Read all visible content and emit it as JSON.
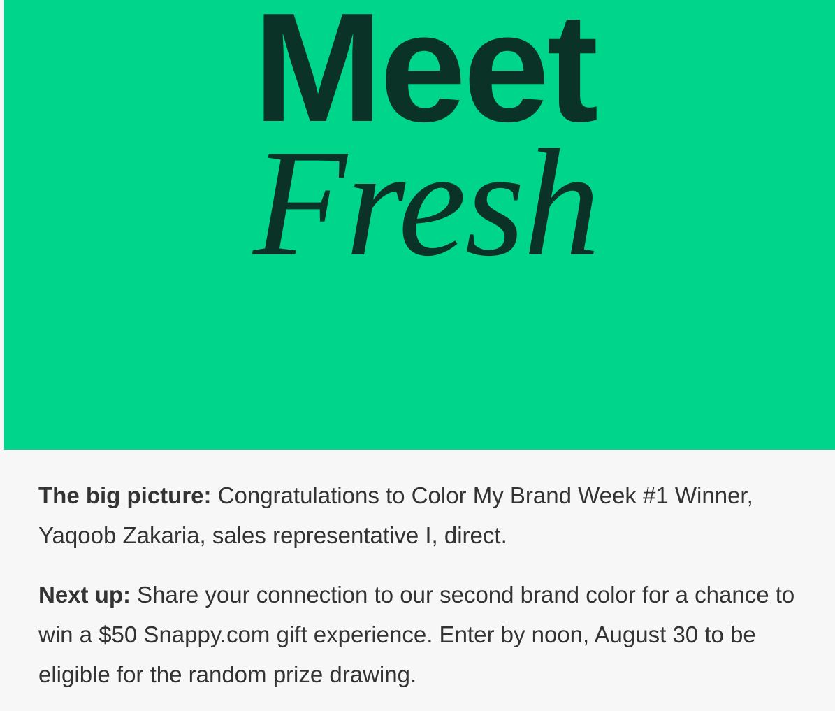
{
  "colors": {
    "hero_background": "#00d68b",
    "hero_text": "#0b3227",
    "body_text": "#333333",
    "page_background": "#f7f7f7"
  },
  "hero": {
    "line1": "Meet",
    "line2": "Fresh"
  },
  "paragraphs": [
    {
      "lead": "The big picture:",
      "text": " Congratulations to Color My Brand Week #1 Winner, Yaqoob Zakaria, sales representative I, direct."
    },
    {
      "lead": "Next up:",
      "text": " Share your connection to our second brand color for a chance to win a $50 Snappy.com gift experience. Enter by noon, August 30 to be eligible for the random prize drawing."
    }
  ]
}
